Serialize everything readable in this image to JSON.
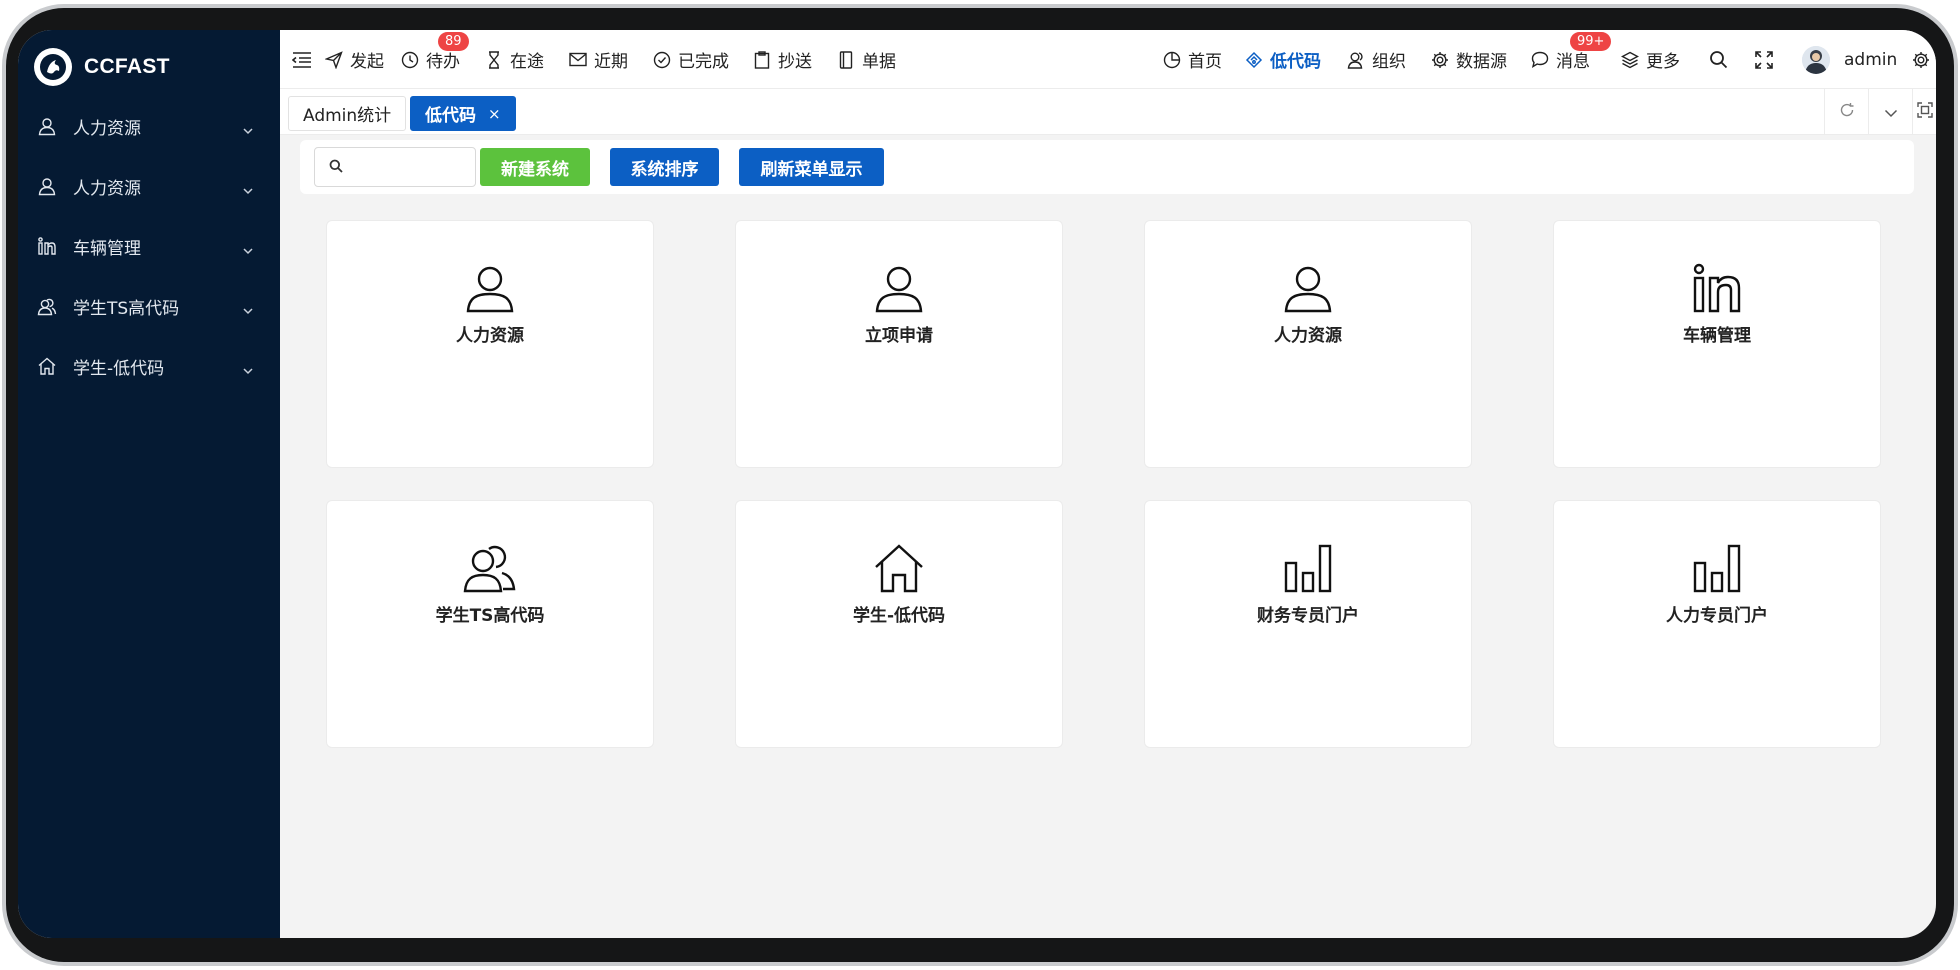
{
  "app": {
    "name": "CCFAST"
  },
  "sidebar": {
    "items": [
      {
        "label": "人力资源",
        "icon": "user-icon"
      },
      {
        "label": "人力资源",
        "icon": "user-icon"
      },
      {
        "label": "车辆管理",
        "icon": "linkedin-icon"
      },
      {
        "label": "学生TS高代码",
        "icon": "team-icon"
      },
      {
        "label": "学生-低代码",
        "icon": "home-icon"
      }
    ]
  },
  "topbar": {
    "left": [
      {
        "label": "发起",
        "icon": "send-icon"
      },
      {
        "label": "待办",
        "icon": "clock-icon",
        "badge": "89"
      },
      {
        "label": "在途",
        "icon": "hourglass-icon"
      },
      {
        "label": "近期",
        "icon": "mail-icon"
      },
      {
        "label": "已完成",
        "icon": "check-circle-icon"
      },
      {
        "label": "抄送",
        "icon": "clipboard-icon"
      },
      {
        "label": "单据",
        "icon": "document-icon"
      }
    ],
    "right": [
      {
        "label": "首页",
        "icon": "dashboard-icon"
      },
      {
        "label": "低代码",
        "icon": "low-code-icon",
        "active": true
      },
      {
        "label": "组织",
        "icon": "org-icon"
      },
      {
        "label": "数据源",
        "icon": "gear-icon"
      },
      {
        "label": "消息",
        "icon": "chat-icon",
        "badge": "99+"
      },
      {
        "label": "更多",
        "icon": "layers-icon"
      }
    ],
    "user": {
      "name": "admin"
    }
  },
  "tabs": [
    {
      "label": "Admin统计",
      "active": false
    },
    {
      "label": "低代码",
      "active": true,
      "close": "×"
    }
  ],
  "toolbar": {
    "search_placeholder": "",
    "buttons": [
      {
        "label": "新建系统",
        "color": "#5cc23d"
      },
      {
        "label": "系统排序",
        "color": "#0c5fc4"
      },
      {
        "label": "刷新菜单显示",
        "color": "#0c5fc4"
      }
    ]
  },
  "systems": [
    {
      "label": "人力资源",
      "icon": "user-icon"
    },
    {
      "label": "立项申请",
      "icon": "user-icon"
    },
    {
      "label": "人力资源",
      "icon": "user-icon"
    },
    {
      "label": "车辆管理",
      "icon": "linkedin-icon"
    },
    {
      "label": "学生TS高代码",
      "icon": "team-icon"
    },
    {
      "label": "学生-低代码",
      "icon": "home-icon"
    },
    {
      "label": "财务专员门户",
      "icon": "bar-chart-icon"
    },
    {
      "label": "人力专员门户",
      "icon": "bar-chart-icon"
    }
  ],
  "colors": {
    "sidebar": "#051a33",
    "accent": "#0c5fc4",
    "success": "#5cc23d",
    "badge": "#ee4444"
  }
}
